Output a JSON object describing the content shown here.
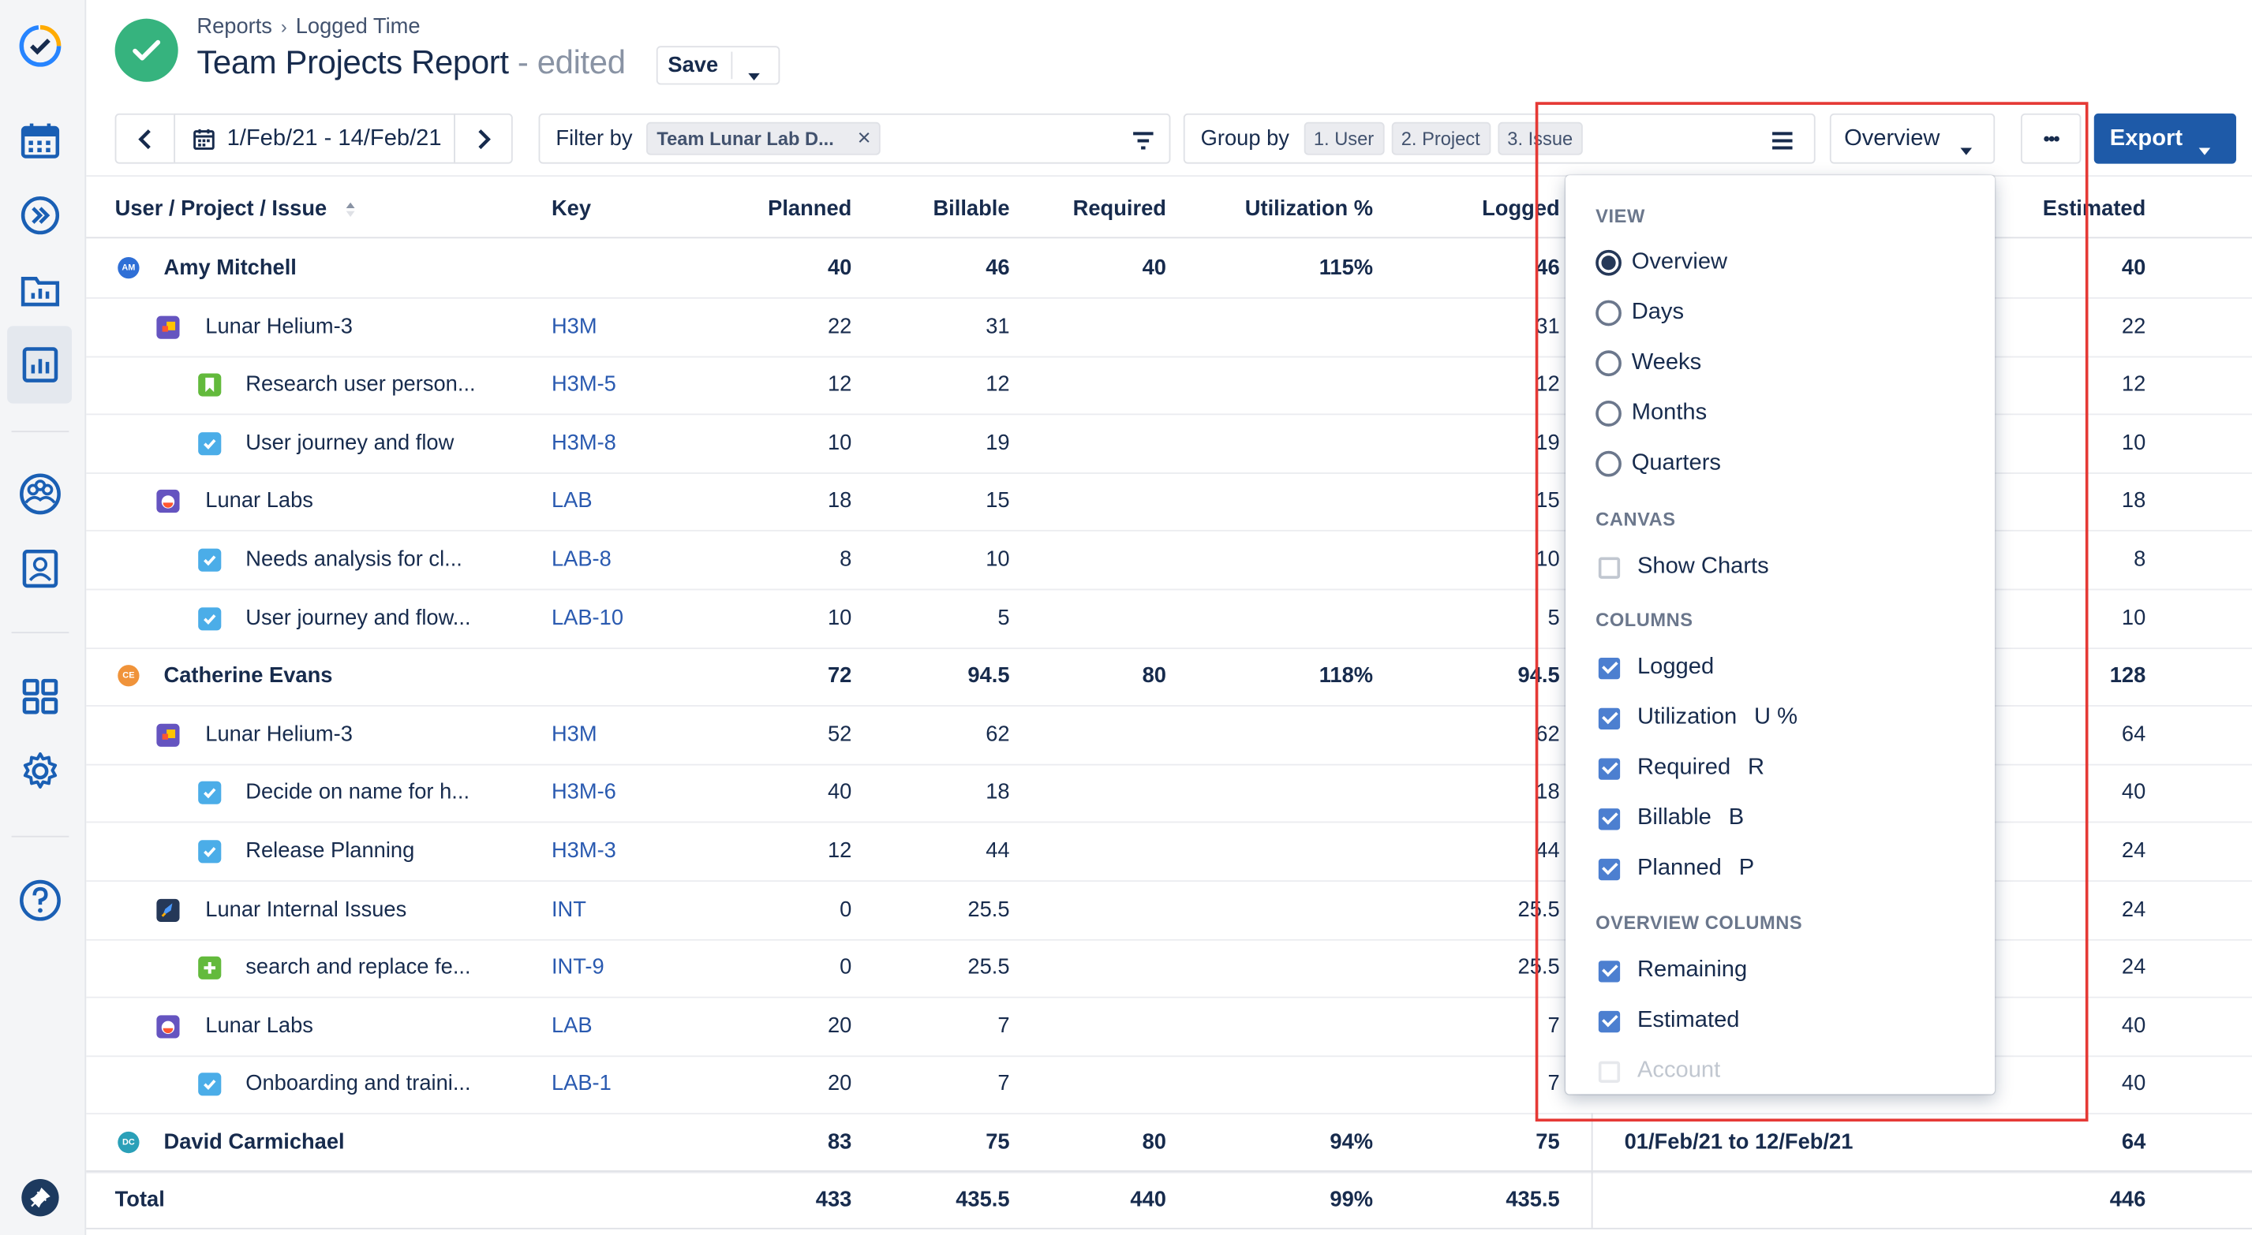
{
  "breadcrumb": {
    "root": "Reports",
    "sep": "›",
    "current": "Logged Time"
  },
  "title": {
    "main": "Team Projects Report",
    "dash": "-",
    "edited": "edited"
  },
  "toolbar": {
    "save": "Save",
    "date_range": "1/Feb/21 - 14/Feb/21",
    "filter_label": "Filter by",
    "filter_chip": "Team Lunar Lab D...",
    "filter_chip_close": "×",
    "group_label": "Group by",
    "group_chips": [
      "1. User",
      "2. Project",
      "3. Issue"
    ],
    "view_button": "Overview",
    "more": "•••",
    "export": "Export"
  },
  "columns": {
    "name": "User / Project / Issue",
    "key": "Key",
    "planned": "Planned",
    "billable": "Billable",
    "required": "Required",
    "utilization": "Utilization %",
    "logged": "Logged",
    "estimated": "Estimated"
  },
  "rows": [
    {
      "level": 0,
      "icon": "avatar",
      "initials": "AM",
      "avatar_color": "#2f6fd6",
      "name": "Amy Mitchell",
      "key": "",
      "planned": "40",
      "billable": "46",
      "required": "40",
      "utilization": "115%",
      "logged": "46",
      "period": "",
      "estimated": "40"
    },
    {
      "level": 1,
      "icon": "project-lunar-helium-icon",
      "name": "Lunar Helium-3",
      "key": "H3M",
      "planned": "22",
      "billable": "31",
      "required": "",
      "utilization": "",
      "logged": "31",
      "period": "",
      "estimated": "22"
    },
    {
      "level": 2,
      "icon": "story-icon",
      "name": "Research user person...",
      "key": "H3M-5",
      "planned": "12",
      "billable": "12",
      "required": "",
      "utilization": "",
      "logged": "12",
      "period": "",
      "estimated": "12"
    },
    {
      "level": 2,
      "icon": "task-icon",
      "name": "User journey and flow",
      "key": "H3M-8",
      "planned": "10",
      "billable": "19",
      "required": "",
      "utilization": "",
      "logged": "19",
      "period": "",
      "estimated": "10"
    },
    {
      "level": 1,
      "icon": "project-lunar-labs-icon",
      "name": "Lunar Labs",
      "key": "LAB",
      "planned": "18",
      "billable": "15",
      "required": "",
      "utilization": "",
      "logged": "15",
      "period": "",
      "estimated": "18"
    },
    {
      "level": 2,
      "icon": "task-icon",
      "name": "Needs analysis for cl...",
      "key": "LAB-8",
      "planned": "8",
      "billable": "10",
      "required": "",
      "utilization": "",
      "logged": "10",
      "period": "",
      "estimated": "8"
    },
    {
      "level": 2,
      "icon": "task-icon",
      "name": "User journey and flow...",
      "key": "LAB-10",
      "planned": "10",
      "billable": "5",
      "required": "",
      "utilization": "",
      "logged": "5",
      "period": "",
      "estimated": "10"
    },
    {
      "level": 0,
      "icon": "avatar",
      "initials": "CE",
      "avatar_color": "#f0933a",
      "name": "Catherine Evans",
      "key": "",
      "planned": "72",
      "billable": "94.5",
      "required": "80",
      "utilization": "118%",
      "logged": "94.5",
      "period": "",
      "estimated": "128"
    },
    {
      "level": 1,
      "icon": "project-lunar-helium-icon",
      "name": "Lunar Helium-3",
      "key": "H3M",
      "planned": "52",
      "billable": "62",
      "required": "",
      "utilization": "",
      "logged": "62",
      "period": "",
      "estimated": "64"
    },
    {
      "level": 2,
      "icon": "task-icon",
      "name": "Decide on name for h...",
      "key": "H3M-6",
      "planned": "40",
      "billable": "18",
      "required": "",
      "utilization": "",
      "logged": "18",
      "period": "",
      "estimated": "40"
    },
    {
      "level": 2,
      "icon": "task-icon",
      "name": "Release Planning",
      "key": "H3M-3",
      "planned": "12",
      "billable": "44",
      "required": "",
      "utilization": "",
      "logged": "44",
      "period": "",
      "estimated": "24"
    },
    {
      "level": 1,
      "icon": "project-rocket-icon",
      "name": "Lunar Internal Issues",
      "key": "INT",
      "planned": "0",
      "billable": "25.5",
      "required": "",
      "utilization": "",
      "logged": "25.5",
      "period": "",
      "estimated": "24"
    },
    {
      "level": 2,
      "icon": "new-feature-icon",
      "name": "search and replace fe...",
      "key": "INT-9",
      "planned": "0",
      "billable": "25.5",
      "required": "",
      "utilization": "",
      "logged": "25.5",
      "period": "",
      "estimated": "24"
    },
    {
      "level": 1,
      "icon": "project-lunar-labs-icon",
      "name": "Lunar Labs",
      "key": "LAB",
      "planned": "20",
      "billable": "7",
      "required": "",
      "utilization": "",
      "logged": "7",
      "period": "",
      "estimated": "40"
    },
    {
      "level": 2,
      "icon": "task-icon",
      "name": "Onboarding and traini...",
      "key": "LAB-1",
      "planned": "20",
      "billable": "7",
      "required": "",
      "utilization": "",
      "logged": "7",
      "period": "",
      "estimated": "40"
    },
    {
      "level": 0,
      "icon": "avatar",
      "initials": "DC",
      "avatar_color": "#2aa0b8",
      "name": "David Carmichael",
      "key": "",
      "planned": "83",
      "billable": "75",
      "required": "80",
      "utilization": "94%",
      "logged": "75",
      "period": "01/Feb/21 to 12/Feb/21",
      "estimated": "64"
    }
  ],
  "total": {
    "label": "Total",
    "planned": "433",
    "billable": "435.5",
    "required": "440",
    "utilization": "99%",
    "logged": "435.5",
    "estimated": "446"
  },
  "dropdown": {
    "view_title": "VIEW",
    "view_options": [
      {
        "label": "Overview",
        "selected": true
      },
      {
        "label": "Days",
        "selected": false
      },
      {
        "label": "Weeks",
        "selected": false
      },
      {
        "label": "Months",
        "selected": false
      },
      {
        "label": "Quarters",
        "selected": false
      }
    ],
    "canvas_title": "CANVAS",
    "canvas_options": [
      {
        "label": "Show Charts",
        "checked": false
      }
    ],
    "columns_title": "COLUMNS",
    "column_options": [
      {
        "label": "Logged",
        "shortcut": "",
        "checked": true
      },
      {
        "label": "Utilization",
        "shortcut": "U %",
        "checked": true
      },
      {
        "label": "Required",
        "shortcut": "R",
        "checked": true
      },
      {
        "label": "Billable",
        "shortcut": "B",
        "checked": true
      },
      {
        "label": "Planned",
        "shortcut": "P",
        "checked": true
      }
    ],
    "overview_title": "OVERVIEW COLUMNS",
    "overview_options": [
      {
        "label": "Remaining",
        "checked": true
      },
      {
        "label": "Estimated",
        "checked": true
      },
      {
        "label": "Account",
        "checked": false,
        "disabled": true
      }
    ]
  },
  "colors": {
    "accent": "#0052cc",
    "export_bg": "#1e5aa8",
    "highlight": "#e53935",
    "success": "#36b37e",
    "link": "#2a5ab0"
  }
}
